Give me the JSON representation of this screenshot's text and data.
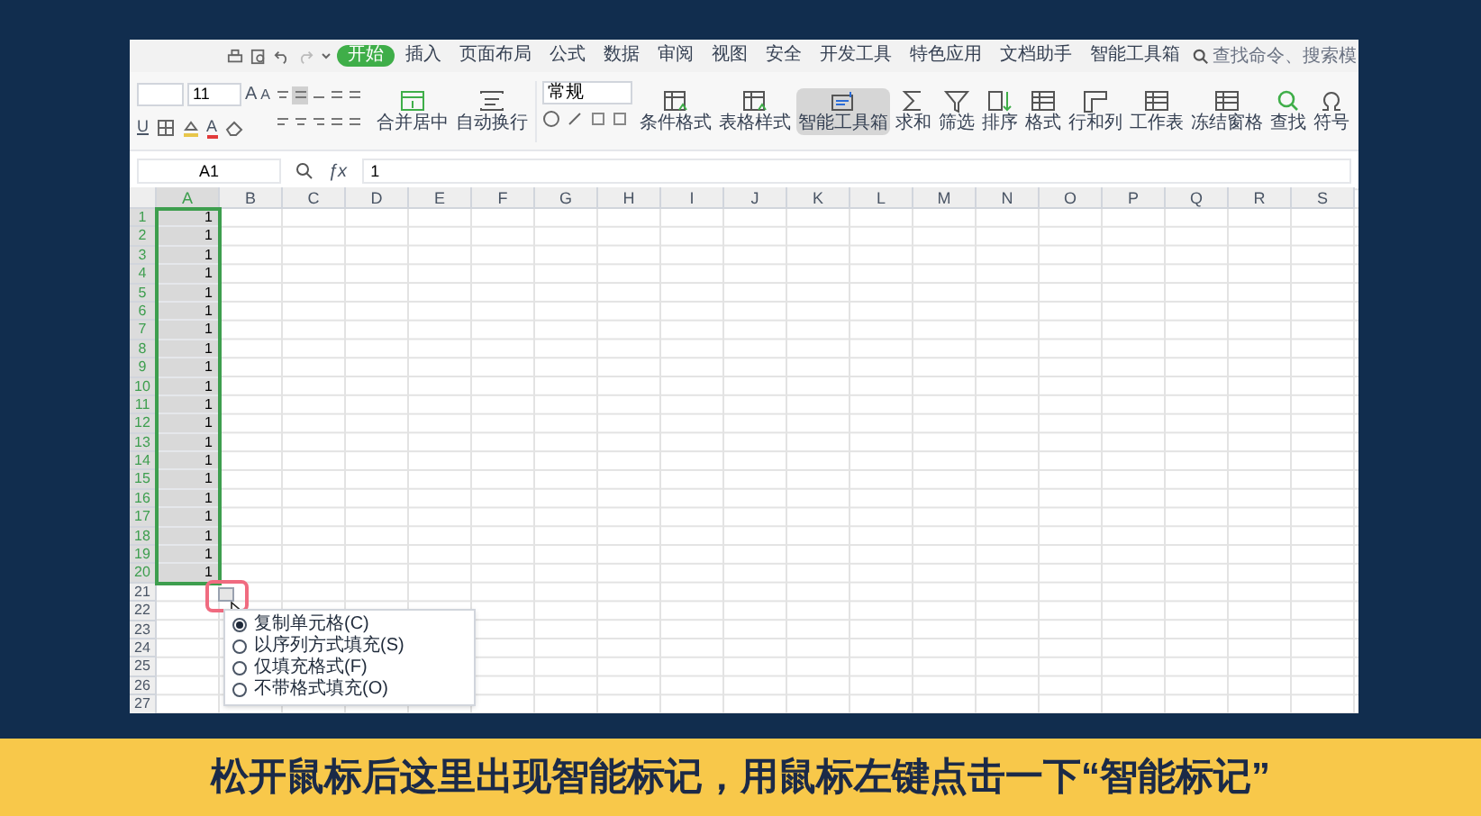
{
  "tabs": [
    {
      "label": "开始",
      "selected": true
    },
    {
      "label": "插入",
      "selected": false
    },
    {
      "label": "页面布局",
      "selected": false
    },
    {
      "label": "公式",
      "selected": false
    },
    {
      "label": "数据",
      "selected": false
    },
    {
      "label": "审阅",
      "selected": false
    },
    {
      "label": "视图",
      "selected": false
    },
    {
      "label": "安全",
      "selected": false
    },
    {
      "label": "开发工具",
      "selected": false
    },
    {
      "label": "特色应用",
      "selected": false
    },
    {
      "label": "文档助手",
      "selected": false
    },
    {
      "label": "智能工具箱",
      "selected": false
    }
  ],
  "search": {
    "placeholder": "查找命令、搜索模"
  },
  "ribbon": {
    "font_size": "11",
    "grow_label": "A",
    "shrink_label": "A",
    "underline_label": "U",
    "color_label": "A",
    "number_format": "常规",
    "buttons": [
      {
        "label": "合并居中",
        "kind": "merge",
        "selected": false
      },
      {
        "label": "自动换行",
        "kind": "wrap",
        "selected": false
      },
      {
        "label": "条件格式",
        "kind": "table",
        "selected": false
      },
      {
        "label": "表格样式",
        "kind": "table",
        "selected": false
      },
      {
        "label": "智能工具箱",
        "kind": "box",
        "selected": true
      },
      {
        "label": "求和",
        "kind": "sum",
        "selected": false
      },
      {
        "label": "筛选",
        "kind": "filter",
        "selected": false
      },
      {
        "label": "排序",
        "kind": "sort",
        "selected": false
      },
      {
        "label": "格式",
        "kind": "grid",
        "selected": false
      },
      {
        "label": "行和列",
        "kind": "rows",
        "selected": false
      },
      {
        "label": "工作表",
        "kind": "grid",
        "selected": false
      },
      {
        "label": "冻结窗格",
        "kind": "grid",
        "selected": false
      },
      {
        "label": "查找",
        "kind": "find",
        "selected": false
      },
      {
        "label": "符号",
        "kind": "symbol",
        "selected": false
      }
    ]
  },
  "formula_bar": {
    "cell_ref": "A1",
    "fx_label": "ƒx",
    "value": "1"
  },
  "sheet": {
    "columns": [
      "A",
      "B",
      "C",
      "D",
      "E",
      "F",
      "G",
      "H",
      "I",
      "J",
      "K",
      "L",
      "M",
      "N",
      "O",
      "P",
      "Q",
      "R",
      "S"
    ],
    "row_numbers": [
      "1",
      "2",
      "3",
      "4",
      "5",
      "6",
      "7",
      "8",
      "9",
      "10",
      "11",
      "12",
      "13",
      "14",
      "15",
      "16",
      "17",
      "18",
      "19",
      "20",
      "21",
      "22",
      "23",
      "24",
      "25",
      "26",
      "27"
    ],
    "column_a": [
      {
        "value": "1",
        "selected": true
      },
      {
        "value": "1",
        "selected": true
      },
      {
        "value": "1",
        "selected": true
      },
      {
        "value": "1",
        "selected": true
      },
      {
        "value": "1",
        "selected": true
      },
      {
        "value": "1",
        "selected": true
      },
      {
        "value": "1",
        "selected": true
      },
      {
        "value": "1",
        "selected": true
      },
      {
        "value": "1",
        "selected": true
      },
      {
        "value": "1",
        "selected": true
      },
      {
        "value": "1",
        "selected": true
      },
      {
        "value": "1",
        "selected": true
      },
      {
        "value": "1",
        "selected": true
      },
      {
        "value": "1",
        "selected": true
      },
      {
        "value": "1",
        "selected": true
      },
      {
        "value": "1",
        "selected": true
      },
      {
        "value": "1",
        "selected": true
      },
      {
        "value": "1",
        "selected": true
      },
      {
        "value": "1",
        "selected": true
      },
      {
        "value": "1",
        "selected": true
      }
    ]
  },
  "smart_tag_menu": {
    "options": [
      {
        "label": "复制单元格(C)",
        "selected": true
      },
      {
        "label": "以序列方式填充(S)",
        "selected": false
      },
      {
        "label": "仅填充格式(F)",
        "selected": false
      },
      {
        "label": "不带格式填充(O)",
        "selected": false
      }
    ]
  },
  "caption": "松开鼠标后这里出现智能标记，用鼠标左键点击一下“智能标记”"
}
